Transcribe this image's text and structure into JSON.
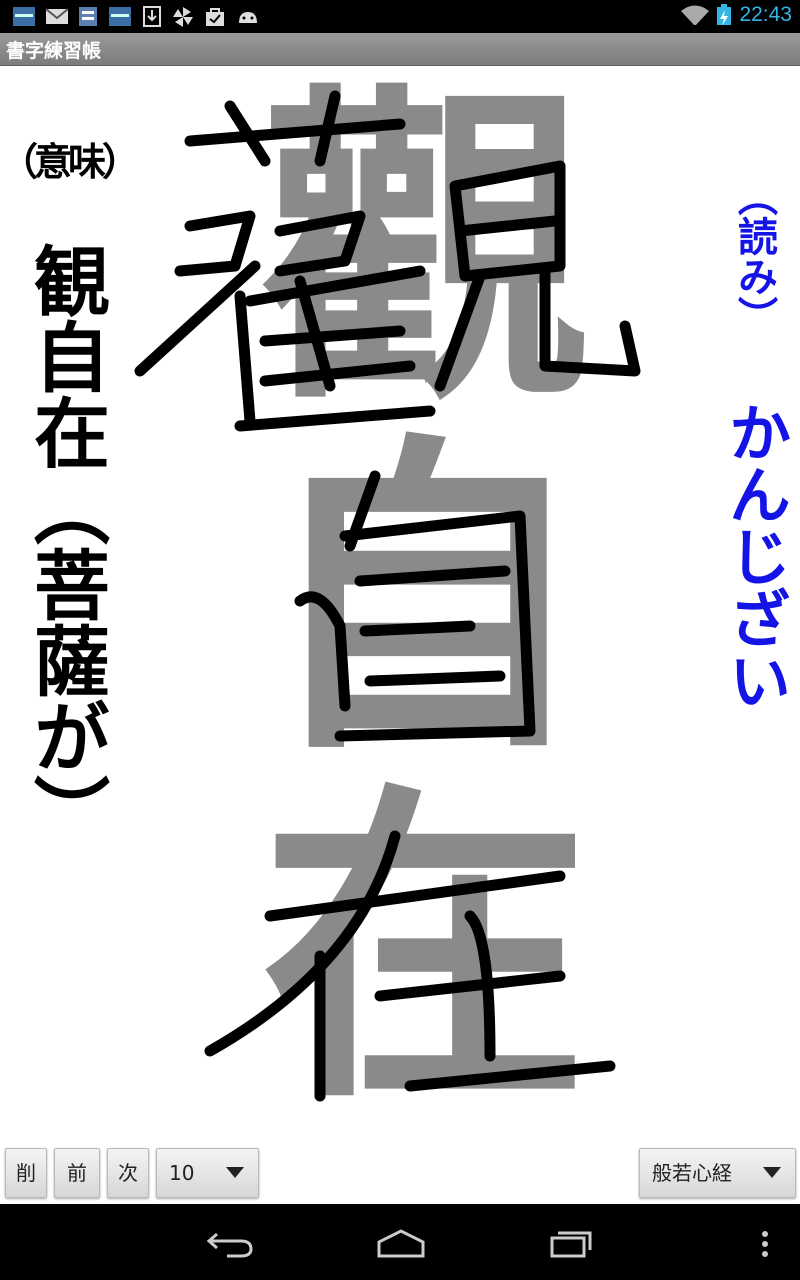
{
  "status": {
    "time": "22:43"
  },
  "app": {
    "title": "書字練習帳"
  },
  "practice": {
    "guide_chars": [
      "觀",
      "自",
      "在"
    ],
    "meaning_header": "（意味）",
    "meaning_text": "観自在（菩薩が）",
    "reading_header": "（読み）",
    "reading_text": "かんじざい"
  },
  "toolbar": {
    "delete_label": "削",
    "prev_label": "前",
    "next_label": "次",
    "size_value": "10",
    "sutra_value": "般若心経"
  },
  "colors": {
    "reading": "#1414e6",
    "guide": "#8a8a8a",
    "time": "#33b5e5"
  }
}
